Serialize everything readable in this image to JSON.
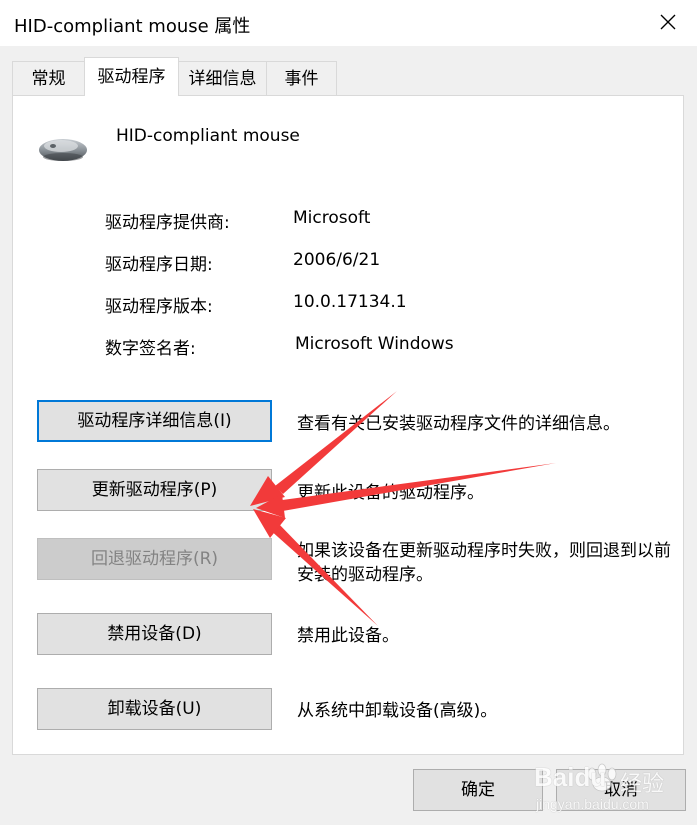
{
  "window": {
    "title": "HID-compliant mouse 属性"
  },
  "tabs": [
    {
      "label": "常规"
    },
    {
      "label": "驱动程序"
    },
    {
      "label": "详细信息"
    },
    {
      "label": "事件"
    }
  ],
  "device": {
    "name": "HID-compliant mouse",
    "icon": "mouse-icon"
  },
  "info": [
    {
      "label": "驱动程序提供商:",
      "value": "Microsoft"
    },
    {
      "label": "驱动程序日期:",
      "value": "2006/6/21"
    },
    {
      "label": "驱动程序版本:",
      "value": "10.0.17134.1"
    },
    {
      "label": "数字签名者:",
      "value": "Microsoft Windows"
    }
  ],
  "actions": [
    {
      "label": "驱动程序详细信息(I)",
      "desc": "查看有关已安装驱动程序文件的详细信息。",
      "state": "focused"
    },
    {
      "label": "更新驱动程序(P)",
      "desc": "更新此设备的驱动程序。",
      "state": "enabled"
    },
    {
      "label": "回退驱动程序(R)",
      "desc": "如果该设备在更新驱动程序时失败，则回退到以前安装的驱动程序。",
      "state": "disabled"
    },
    {
      "label": "禁用设备(D)",
      "desc": "禁用此设备。",
      "state": "enabled"
    },
    {
      "label": "卸载设备(U)",
      "desc": "从系统中卸载设备(高级)。",
      "state": "enabled"
    }
  ],
  "footer": {
    "ok_label": "确定",
    "cancel_label": "取消"
  },
  "annotation": {
    "arrow_color": "#f23a3a"
  },
  "watermark": {
    "brand": "Baidu",
    "suffix": "经验",
    "url": "jingyan.baidu.com"
  }
}
